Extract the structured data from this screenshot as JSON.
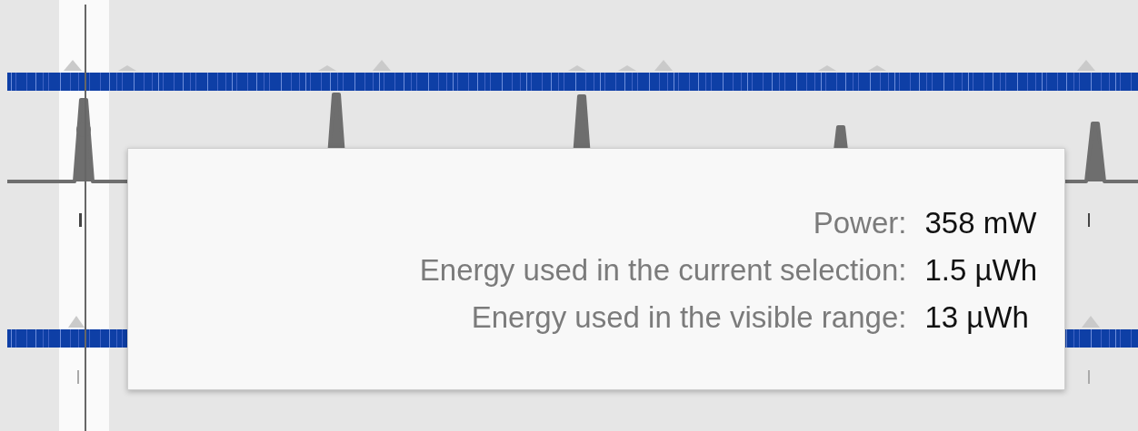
{
  "tooltip": {
    "rows": [
      {
        "label": "Power:",
        "value": "358 mW"
      },
      {
        "label": "Energy used in the current selection:",
        "value": "1.5 µWh"
      },
      {
        "label": "Energy used in the visible range:",
        "value": "13 µWh"
      }
    ]
  }
}
